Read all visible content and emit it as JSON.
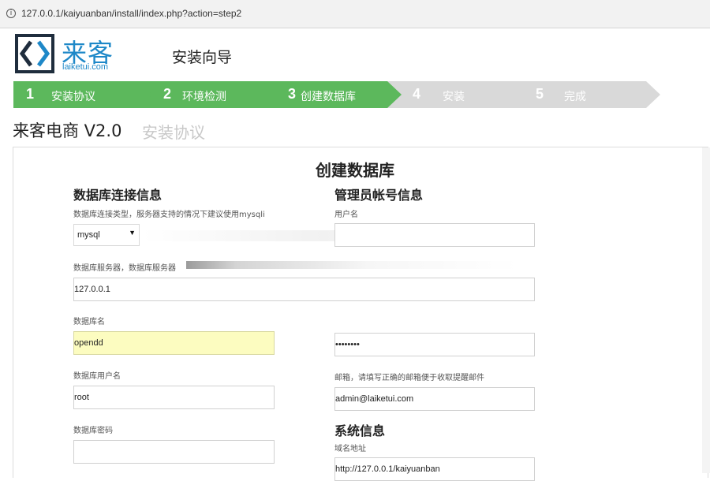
{
  "browser": {
    "url": "127.0.0.1/kaiyuanban/install/index.php?action=step2"
  },
  "header": {
    "logo_text": "来客",
    "logo_domain": "laiketui.com",
    "wizard_title": "安装向导"
  },
  "steps": [
    {
      "num": "1",
      "label": "安装协议",
      "state": "done"
    },
    {
      "num": "2",
      "label": "环境检测",
      "state": "done"
    },
    {
      "num": "3",
      "label": "创建数据库",
      "state": "current"
    },
    {
      "num": "4",
      "label": "安装",
      "state": "pending"
    },
    {
      "num": "5",
      "label": "完成",
      "state": "pending"
    }
  ],
  "product": {
    "name": "来客电商 V2.0",
    "subtitle": "安装协议"
  },
  "form": {
    "title": "创建数据库",
    "db": {
      "heading": "数据库连接信息",
      "type_label": "数据库连接类型，服务器支持的情况下建议使用mysqli",
      "type_value": "mysql",
      "server_label": "数据库服务器，数据库服务器",
      "server_value": "127.0.0.1",
      "name_label": "数据库名",
      "name_value": "opendd",
      "user_label": "数据库用户名",
      "user_value": "root",
      "password_label": "数据库密码",
      "password_value": ""
    },
    "admin": {
      "heading": "管理员帐号信息",
      "username_label": "用户名",
      "username_value": "",
      "field2_value": "",
      "password_value": "••••••••",
      "email_label": "邮箱，请填写正确的邮箱便于收取提醒邮件",
      "email_value": "admin@laiketui.com"
    },
    "system": {
      "heading": "系统信息",
      "domain_label": "域名地址",
      "domain_value": "http://127.0.0.1/kaiyuanban"
    }
  },
  "colors": {
    "step_active": "#5cb85c",
    "step_inactive": "#d9d9d9",
    "brand": "#1e88c8"
  }
}
